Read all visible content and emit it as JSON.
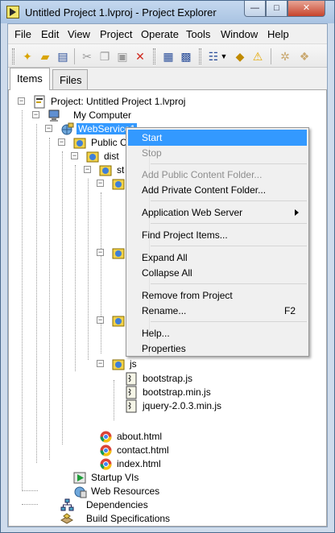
{
  "window": {
    "title": "Untitled Project 1.lvproj - Project Explorer",
    "controls": {
      "minimize": "—",
      "maximize": "□",
      "close": "✕"
    }
  },
  "menubar": {
    "items": [
      "File",
      "Edit",
      "View",
      "Project",
      "Operate",
      "Tools",
      "Window",
      "Help"
    ]
  },
  "toolbar": {
    "icons": [
      "new-icon",
      "open-icon",
      "save-all-icon",
      "cut-icon",
      "copy-icon",
      "paste-icon",
      "delete-icon",
      "build-icon",
      "deploy-icon",
      "view-options-icon",
      "dropdown-icon",
      "error-list-icon",
      "warning-icon",
      "settings-icon",
      "properties-icon"
    ]
  },
  "tabs": [
    {
      "label": "Items",
      "active": true
    },
    {
      "label": "Files",
      "active": false
    }
  ],
  "tree": {
    "project": "Project: Untitled Project 1.lvproj",
    "computer": "My Computer",
    "webservice": "WebService1",
    "public_content": "Public C",
    "dist": "dist",
    "st": "st",
    "js": "js",
    "files_js": [
      "bootstrap.js",
      "bootstrap.min.js",
      "jquery-2.0.3.min.js"
    ],
    "files_html": [
      "about.html",
      "contact.html",
      "index.html"
    ],
    "startup": "Startup VIs",
    "web_resources": "Web Resources",
    "dependencies": "Dependencies",
    "build_specs": "Build Specifications"
  },
  "context_menu": {
    "items": [
      {
        "label": "Start",
        "state": "highlight"
      },
      {
        "label": "Stop",
        "state": "disabled"
      },
      {
        "label": "Add Public Content Folder...",
        "state": "disabled"
      },
      {
        "label": "Add Private Content Folder...",
        "state": "normal"
      },
      {
        "label": "Application Web Server",
        "state": "normal",
        "submenu": true
      },
      {
        "label": "Find Project Items...",
        "state": "normal"
      },
      {
        "label": "Expand All",
        "state": "normal"
      },
      {
        "label": "Collapse All",
        "state": "normal"
      },
      {
        "label": "Remove from Project",
        "state": "normal"
      },
      {
        "label": "Rename...",
        "state": "normal",
        "shortcut": "F2"
      },
      {
        "label": "Help...",
        "state": "normal"
      },
      {
        "label": "Properties",
        "state": "normal"
      }
    ]
  },
  "colors": {
    "selection": "#3399ff",
    "titlebar": "#b9cfe9",
    "close_button": "#c7442c"
  }
}
